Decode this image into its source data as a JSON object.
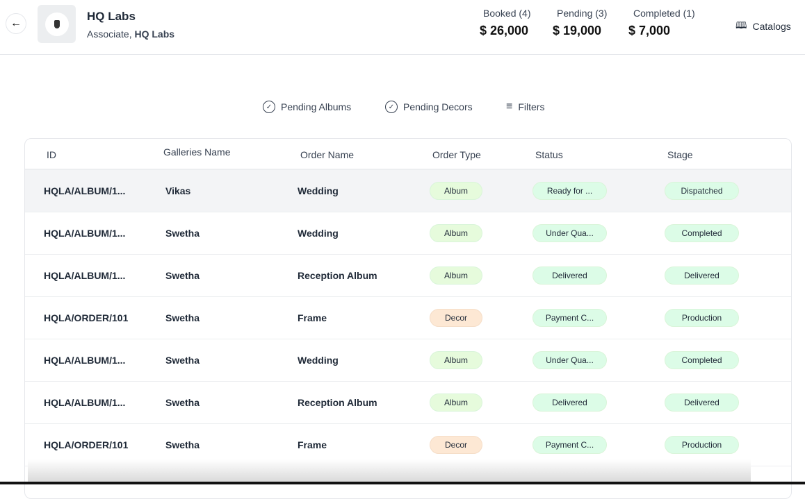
{
  "header": {
    "back_icon": "arrow-left-icon",
    "title": "HQ Labs",
    "subtitle_prefix": "Associate, ",
    "subtitle_org": "HQ Labs",
    "stats": [
      {
        "label": "Booked (4)",
        "value": "$ 26,000"
      },
      {
        "label": "Pending (3)",
        "value": "$ 19,000"
      },
      {
        "label": "Completed (1)",
        "value": "$ 7,000"
      }
    ],
    "catalogs": "Catalogs"
  },
  "filters": {
    "pending_albums": "Pending Albums",
    "pending_decors": "Pending Decors",
    "filters": "Filters"
  },
  "table": {
    "columns": [
      "ID",
      "Galleries Name",
      "Order Name",
      "Order Type",
      "Status",
      "Stage"
    ],
    "rows": [
      {
        "id": "HQLA/ALBUM/1...",
        "gallery": "Vikas",
        "order": "Wedding",
        "type": "Album",
        "status": "Ready for ...",
        "stage": "Dispatched"
      },
      {
        "id": "HQLA/ALBUM/1...",
        "gallery": "Swetha",
        "order": "Wedding",
        "type": "Album",
        "status": "Under Qua...",
        "stage": "Completed"
      },
      {
        "id": "HQLA/ALBUM/1...",
        "gallery": "Swetha",
        "order": "Reception Album",
        "type": "Album",
        "status": "Delivered",
        "stage": "Delivered"
      },
      {
        "id": "HQLA/ORDER/101",
        "gallery": "Swetha",
        "order": "Frame",
        "type": "Decor",
        "status": "Payment C...",
        "stage": "Production"
      },
      {
        "id": "HQLA/ALBUM/1...",
        "gallery": "Swetha",
        "order": "Wedding",
        "type": "Album",
        "status": "Under Qua...",
        "stage": "Completed"
      },
      {
        "id": "HQLA/ALBUM/1...",
        "gallery": "Swetha",
        "order": "Reception Album",
        "type": "Album",
        "status": "Delivered",
        "stage": "Delivered"
      },
      {
        "id": "HQLA/ORDER/101",
        "gallery": "Swetha",
        "order": "Frame",
        "type": "Decor",
        "status": "Payment C...",
        "stage": "Production"
      }
    ]
  }
}
